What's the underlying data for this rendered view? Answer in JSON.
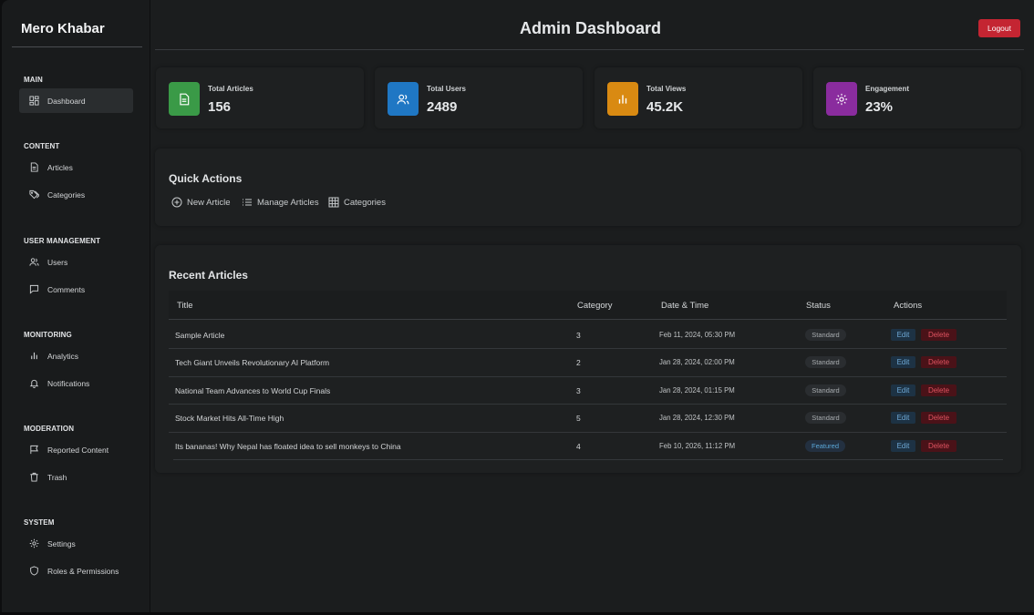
{
  "brand": "Mero Khabar",
  "sidebar": {
    "sections": [
      {
        "title": "MAIN",
        "items": [
          {
            "label": "Dashboard",
            "icon": "dashboard-icon",
            "active": true
          }
        ]
      },
      {
        "title": "CONTENT",
        "items": [
          {
            "label": "Articles",
            "icon": "file-icon"
          },
          {
            "label": "Categories",
            "icon": "tags-icon"
          }
        ]
      },
      {
        "title": "USER MANAGEMENT",
        "items": [
          {
            "label": "Users",
            "icon": "users-icon"
          },
          {
            "label": "Comments",
            "icon": "comment-icon"
          }
        ]
      },
      {
        "title": "MONITORING",
        "items": [
          {
            "label": "Analytics",
            "icon": "bar-chart-icon"
          },
          {
            "label": "Notifications",
            "icon": "bell-icon"
          }
        ]
      },
      {
        "title": "MODERATION",
        "items": [
          {
            "label": "Reported Content",
            "icon": "flag-icon"
          },
          {
            "label": "Trash",
            "icon": "trash-icon"
          }
        ]
      },
      {
        "title": "SYSTEM",
        "items": [
          {
            "label": "Settings",
            "icon": "gear-icon"
          },
          {
            "label": "Roles & Permissions",
            "icon": "shield-icon"
          }
        ]
      }
    ]
  },
  "header": {
    "title": "Admin Dashboard",
    "logout_label": "Logout"
  },
  "stats": [
    {
      "label": "Total Articles",
      "value": "156",
      "icon": "file-icon",
      "color": "#3a9a47"
    },
    {
      "label": "Total Users",
      "value": "2489",
      "icon": "users-icon",
      "color": "#1f77c4"
    },
    {
      "label": "Total Views",
      "value": "45.2K",
      "icon": "bar-chart-icon",
      "color": "#d98a12"
    },
    {
      "label": "Engagement",
      "value": "23%",
      "icon": "gear-icon",
      "color": "#8a2c9e"
    }
  ],
  "quick_actions": {
    "title": "Quick Actions",
    "items": [
      {
        "label": "New Article",
        "icon": "plus-circle-icon"
      },
      {
        "label": "Manage Articles",
        "icon": "list-icon"
      },
      {
        "label": "Categories",
        "icon": "grid-icon"
      }
    ]
  },
  "recent_articles": {
    "title": "Recent Articles",
    "columns": [
      "Title",
      "Category",
      "Date & Time",
      "Status",
      "Actions"
    ],
    "edit_label": "Edit",
    "delete_label": "Delete",
    "rows": [
      {
        "title": "Sample Article",
        "category": "3",
        "date": "Feb 11, 2024, 05:30 PM",
        "status": "Standard"
      },
      {
        "title": "Tech Giant Unveils Revolutionary AI Platform",
        "category": "2",
        "date": "Jan 28, 2024, 02:00 PM",
        "status": "Standard"
      },
      {
        "title": "National Team Advances to World Cup Finals",
        "category": "3",
        "date": "Jan 28, 2024, 01:15 PM",
        "status": "Standard"
      },
      {
        "title": "Stock Market Hits All-Time High",
        "category": "5",
        "date": "Jan 28, 2024, 12:30 PM",
        "status": "Standard"
      },
      {
        "title": "Its bananas! Why Nepal has floated idea to sell monkeys to China",
        "category": "4",
        "date": "Feb 10, 2026, 11:12 PM",
        "status": "Featured"
      }
    ]
  }
}
